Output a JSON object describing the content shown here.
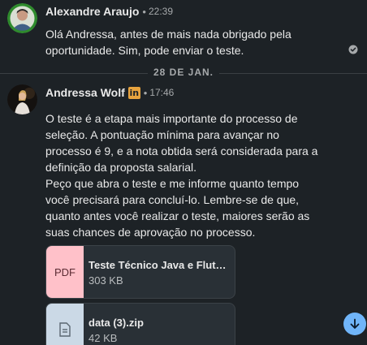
{
  "messages": [
    {
      "sender": "Alexandre Araujo",
      "separator": "•",
      "time": "22:39",
      "paragraphs": [
        "Olá Andressa, antes de mais nada obrigado pela oportunidade. Sim, pode enviar o teste."
      ],
      "read_icon": "check-circle-icon"
    },
    {
      "sender": "Andressa Wolf",
      "badge": "in",
      "separator": "•",
      "time": "17:46",
      "paragraphs": [
        "O teste é a etapa mais importante do processo de seleção. A pontuação mínima para avançar no processo é 9, e a nota obtida será considerada para a definição da proposta salarial.",
        "Peço que abra o teste e me informe quanto tempo você precisará para concluí-lo. Lembre-se de que, quanto antes você realizar o teste, maiores serão as suas chances de aprovação no processo."
      ],
      "attachments": [
        {
          "thumb_label": "PDF",
          "name": "Teste Técnico Java e Flutter",
          "size": "303 KB",
          "icon": "pdf-file-icon"
        },
        {
          "thumb_label": "",
          "name": "data (3).zip",
          "size": "42 KB",
          "icon": "document-file-icon"
        }
      ]
    }
  ],
  "date_divider": "28 DE JAN.",
  "scroll_button_icon": "arrow-down-icon",
  "colors": {
    "background": "#1d2226",
    "text": "#e9e9e9",
    "muted": "#a6a9ab",
    "linkedin_badge": "#e7a33e",
    "pdf_thumb": "#ffc1c9",
    "zip_thumb": "#cbd9e6",
    "scroll_button": "#70b5f9"
  }
}
